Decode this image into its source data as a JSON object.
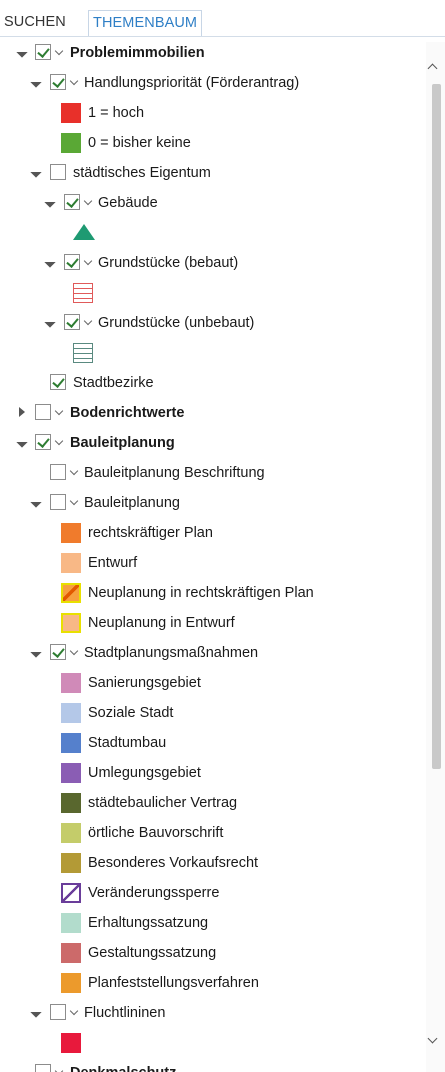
{
  "tabs": {
    "search": "SUCHEN",
    "tree": "THEMENBAUM"
  },
  "tree": {
    "problem": "Problemimmobilien",
    "handlung": "Handlungspriorität (Förderantrag)",
    "hoch": "1 = hoch",
    "keine": "0 = bisher keine",
    "staedtisch": "städtisches Eigentum",
    "gebaeude": "Gebäude",
    "bebaut": "Grundstücke (bebaut)",
    "unbebaut": "Grundstücke (unbebaut)",
    "stadtbezirke": "Stadtbezirke",
    "boden": "Bodenrichtwerte",
    "bauleit": "Bauleitplanung",
    "bauleit_beschr": "Bauleitplanung Beschriftung",
    "bauleit_sub": "Bauleitplanung",
    "rechtskraeftig": "rechtskräftiger Plan",
    "entwurf": "Entwurf",
    "neuplanung_rk": "Neuplanung in rechtskräftigen Plan",
    "neuplanung_entwurf": "Neuplanung in Entwurf",
    "stadtplanung": "Stadtplanungsmaßnahmen",
    "sanierung": "Sanierungsgebiet",
    "soziale": "Soziale Stadt",
    "stadtumbau": "Stadtumbau",
    "umlegung": "Umlegungsgebiet",
    "vertrag": "städtebaulicher Vertrag",
    "bauvorschrift": "örtliche Bauvorschrift",
    "vorkauf": "Besonderes Vorkaufsrecht",
    "veraenderung": "Veränderungssperre",
    "erhaltung": "Erhaltungssatzung",
    "gestaltung": "Gestaltungssatzung",
    "planfeststellung": "Planfeststellungsverfahren",
    "fluchtlinien": "Fluchtlininen",
    "denkmal": "Denkmalschutz"
  },
  "colors": {
    "hoch": "#e8302a",
    "keine": "#5aa835",
    "gebaeude": "#1e9a72",
    "rechtskraeftig": "#f07b2c",
    "entwurf": "#f8b886",
    "neuplanung_entwurf": "#f8b886",
    "sanierung": "#d08ab8",
    "soziale": "#b4c8e8",
    "stadtumbau": "#5580cc",
    "umlegung": "#8a5db4",
    "vertrag": "#59672e",
    "bauvorschrift": "#c4cc6a",
    "vorkauf": "#b39a36",
    "erhaltung": "#b2dccc",
    "gestaltung": "#cc6a6a",
    "planfeststellung": "#ec9a2c",
    "fluchtlinien": "#e8193c"
  }
}
